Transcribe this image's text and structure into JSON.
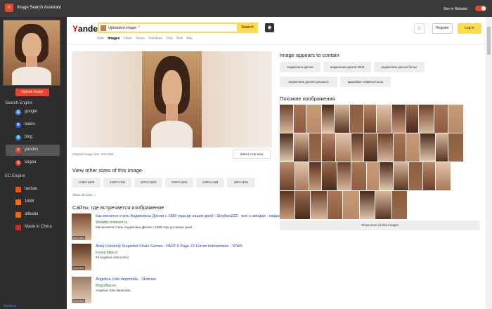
{
  "app": {
    "title": "Image Search Assistant",
    "see_in_website": "See in Website:"
  },
  "sidebar": {
    "upload_label": "Upload Image",
    "search_engine_heading": "Search Engine",
    "engines": [
      {
        "label": "google",
        "icon": "google-icon",
        "color": "#4285f4"
      },
      {
        "label": "baidu",
        "icon": "baidu-icon",
        "color": "#2b5ad8"
      },
      {
        "label": "bing",
        "icon": "bing-icon",
        "color": "#1e88e5"
      },
      {
        "label": "yandex",
        "icon": "yandex-icon",
        "color": "#e8452c"
      },
      {
        "label": "sogou",
        "icon": "sogou-icon",
        "color": "#e8452c"
      }
    ],
    "ec_heading": "EC Engine",
    "ec_engines": [
      {
        "label": "taobao",
        "icon": "taobao-icon",
        "color": "#ff5000"
      },
      {
        "label": "1688",
        "icon": "1688-icon",
        "color": "#ff6a00"
      },
      {
        "label": "alibaba",
        "icon": "alibaba-icon",
        "color": "#ff6a00"
      },
      {
        "label": "Made in China",
        "icon": "made-in-china-icon",
        "color": "#d9281e"
      }
    ],
    "feedback": "feedback"
  },
  "yandex": {
    "logo_prefix": "Y",
    "logo_rest": "andex",
    "search_value": "Uploaded image",
    "search_button": "Search",
    "nav": [
      "Web",
      "Images",
      "Video",
      "News",
      "Translate",
      "Disk",
      "Mail",
      "Ads"
    ],
    "register": "Register",
    "login": "Log in"
  },
  "main": {
    "original_size": "Original image size: 320×480",
    "select_crop": "Select crop area",
    "other_sizes_heading": "View other sizes of this image",
    "sizes": [
      "1339×1940",
      "1200×1794",
      "1070×1600",
      "1000×1500",
      "1000×1495",
      "800×1196"
    ],
    "show_all_sizes": "Show all sizes ⌄",
    "sites_heading": "Сайты, где встречается изображение",
    "sites": [
      {
        "title": "Как менялся стиль Анджелины Джоли с 1986 года до наших дней - ШоуБизZZZ - всё о звёздах - медиаплатформа МирТесен",
        "url": "Showbiz.mirtesen.ru",
        "desc": "Как менялся стиль Анджелины Джоли с 1986 года до наших дней",
        "dim": "640×960"
      },
      {
        "title": "Arsip Celebrity Snapshot Chain Games : PART II Page 22 Forum Indowebster - IDWS",
        "url": "Forum.idws.id",
        "desc": "#3 Angelina Jolie (USA)",
        "dim": "200×302"
      },
      {
        "title": "Angelina Jolie deprimida. - Noticias",
        "url": "Biografias.es",
        "desc": "Angelina Jolie deprimida.",
        "dim": "200×300"
      }
    ],
    "appears_heading": "Image appears to contain",
    "tags": [
      "анджелина джоли",
      "анджелина джоли 2004",
      "анджелина джоли белье",
      "анджелина джоли декольте",
      "красивые знаменитости"
    ],
    "similar_heading": "Похожие изображения",
    "more_similar": "Show more similar images"
  }
}
